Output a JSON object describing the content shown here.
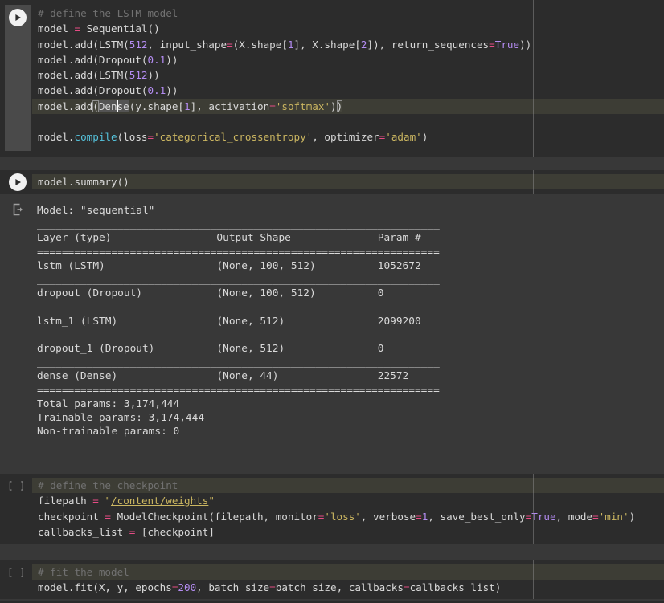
{
  "app": "colab-notebook-dark",
  "colors": {
    "page_bg": "#383838",
    "cell_bg": "#2c2c2c",
    "focused_gutter": "#4a4a4a",
    "line_highlight": "#3d3d35",
    "code_default": "#d9d9d9",
    "comment": "#717171",
    "operator_pink": "#e64c85",
    "number_purple": "#b48cf2",
    "string_yellow": "#cbb661",
    "builtin_cyan": "#55c2db",
    "output_text": "#d9d9d9"
  },
  "cells": [
    {
      "type": "code",
      "focused": true,
      "run_icon": "play",
      "lines": [
        {
          "hl": false,
          "tokens": [
            [
              "com",
              "# define the LSTM model"
            ]
          ]
        },
        {
          "hl": false,
          "tokens": [
            [
              "def",
              "model "
            ],
            [
              "op",
              "="
            ],
            [
              "def",
              " Sequential()"
            ]
          ]
        },
        {
          "hl": false,
          "tokens": [
            [
              "def",
              "model.add(LSTM("
            ],
            [
              "num",
              "512"
            ],
            [
              "def",
              ", input_shape"
            ],
            [
              "op",
              "="
            ],
            [
              "def",
              "(X.shape["
            ],
            [
              "num",
              "1"
            ],
            [
              "def",
              "], X.shape["
            ],
            [
              "num",
              "2"
            ],
            [
              "def",
              "]), return_sequences"
            ],
            [
              "op",
              "="
            ],
            [
              "kw",
              "True"
            ],
            [
              "def",
              "))"
            ]
          ]
        },
        {
          "hl": false,
          "tokens": [
            [
              "def",
              "model.add(Dropout("
            ],
            [
              "num",
              "0.1"
            ],
            [
              "def",
              "))"
            ]
          ]
        },
        {
          "hl": false,
          "tokens": [
            [
              "def",
              "model.add(LSTM("
            ],
            [
              "num",
              "512"
            ],
            [
              "def",
              "))"
            ]
          ]
        },
        {
          "hl": false,
          "tokens": [
            [
              "def",
              "model.add(Dropout("
            ],
            [
              "num",
              "0.1"
            ],
            [
              "def",
              "))"
            ]
          ]
        },
        {
          "hl": true,
          "tokens": [
            [
              "def",
              "model.add"
            ],
            [
              "brk",
              "("
            ],
            [
              "whl",
              "Den"
            ],
            [
              "cursor",
              ""
            ],
            [
              "whl",
              "se"
            ],
            [
              "def",
              "(y.shape["
            ],
            [
              "num",
              "1"
            ],
            [
              "def",
              "], activation"
            ],
            [
              "op",
              "="
            ],
            [
              "str",
              "'softmax'"
            ],
            [
              "def",
              ")"
            ],
            [
              "brk",
              ")"
            ]
          ]
        },
        {
          "hl": false,
          "tokens": []
        },
        {
          "hl": false,
          "tokens": [
            [
              "def",
              "model."
            ],
            [
              "bi",
              "compile"
            ],
            [
              "def",
              "(loss"
            ],
            [
              "op",
              "="
            ],
            [
              "str",
              "'categorical_crossentropy'"
            ],
            [
              "def",
              ", optimizer"
            ],
            [
              "op",
              "="
            ],
            [
              "str",
              "'adam'"
            ],
            [
              "def",
              ")"
            ]
          ]
        }
      ]
    },
    {
      "type": "code",
      "focused": false,
      "run_icon": "play",
      "lines": [
        {
          "hl": true,
          "tokens": [
            [
              "def",
              "model.summary()"
            ]
          ]
        }
      ],
      "output_lines": [
        "Model: \"sequential\"",
        "_________________________________________________________________",
        "Layer (type)                 Output Shape              Param #   ",
        "=================================================================",
        "lstm (LSTM)                  (None, 100, 512)          1052672   ",
        "_________________________________________________________________",
        "dropout (Dropout)            (None, 100, 512)          0         ",
        "_________________________________________________________________",
        "lstm_1 (LSTM)                (None, 512)               2099200   ",
        "_________________________________________________________________",
        "dropout_1 (Dropout)          (None, 512)               0         ",
        "_________________________________________________________________",
        "dense (Dense)                (None, 44)                22572     ",
        "=================================================================",
        "Total params: 3,174,444",
        "Trainable params: 3,174,444",
        "Non-trainable params: 0",
        "_________________________________________________________________"
      ],
      "model_summary_table": {
        "model_name": "sequential",
        "columns": [
          "Layer (type)",
          "Output Shape",
          "Param #"
        ],
        "rows": [
          [
            "lstm (LSTM)",
            "(None, 100, 512)",
            "1052672"
          ],
          [
            "dropout (Dropout)",
            "(None, 100, 512)",
            "0"
          ],
          [
            "lstm_1 (LSTM)",
            "(None, 512)",
            "2099200"
          ],
          [
            "dropout_1 (Dropout)",
            "(None, 512)",
            "0"
          ],
          [
            "dense (Dense)",
            "(None, 44)",
            "22572"
          ]
        ],
        "total_params": "3,174,444",
        "trainable_params": "3,174,444",
        "non_trainable_params": "0"
      }
    },
    {
      "type": "code",
      "focused": false,
      "run_icon": "brackets",
      "exec_label": "[ ]",
      "lines": [
        {
          "hl": true,
          "tokens": [
            [
              "com",
              "# define the checkpoint"
            ]
          ]
        },
        {
          "hl": false,
          "tokens": [
            [
              "def",
              "filepath "
            ],
            [
              "op",
              "="
            ],
            [
              "def",
              " "
            ],
            [
              "str",
              "\""
            ],
            [
              "lnk",
              "/content/weights"
            ],
            [
              "str",
              "\""
            ]
          ]
        },
        {
          "hl": false,
          "tokens": [
            [
              "def",
              "checkpoint "
            ],
            [
              "op",
              "="
            ],
            [
              "def",
              " ModelCheckpoint(filepath, monitor"
            ],
            [
              "op",
              "="
            ],
            [
              "str",
              "'loss'"
            ],
            [
              "def",
              ", verbose"
            ],
            [
              "op",
              "="
            ],
            [
              "num",
              "1"
            ],
            [
              "def",
              ", save_best_only"
            ],
            [
              "op",
              "="
            ],
            [
              "kw",
              "True"
            ],
            [
              "def",
              ", mode"
            ],
            [
              "op",
              "="
            ],
            [
              "str",
              "'min'"
            ],
            [
              "def",
              ")"
            ]
          ]
        },
        {
          "hl": false,
          "tokens": [
            [
              "def",
              "callbacks_list "
            ],
            [
              "op",
              "="
            ],
            [
              "def",
              " [checkpoint]"
            ]
          ]
        }
      ]
    },
    {
      "type": "code",
      "focused": false,
      "run_icon": "brackets",
      "exec_label": "[ ]",
      "lines": [
        {
          "hl": true,
          "tokens": [
            [
              "com",
              "# fit the model"
            ]
          ]
        },
        {
          "hl": false,
          "tokens": [
            [
              "def",
              "model.fit(X, y, epochs"
            ],
            [
              "op",
              "="
            ],
            [
              "num",
              "200"
            ],
            [
              "def",
              ", batch_size"
            ],
            [
              "op",
              "="
            ],
            [
              "def",
              "batch_size, callbacks"
            ],
            [
              "op",
              "="
            ],
            [
              "def",
              "callbacks_list)"
            ]
          ]
        }
      ]
    }
  ]
}
